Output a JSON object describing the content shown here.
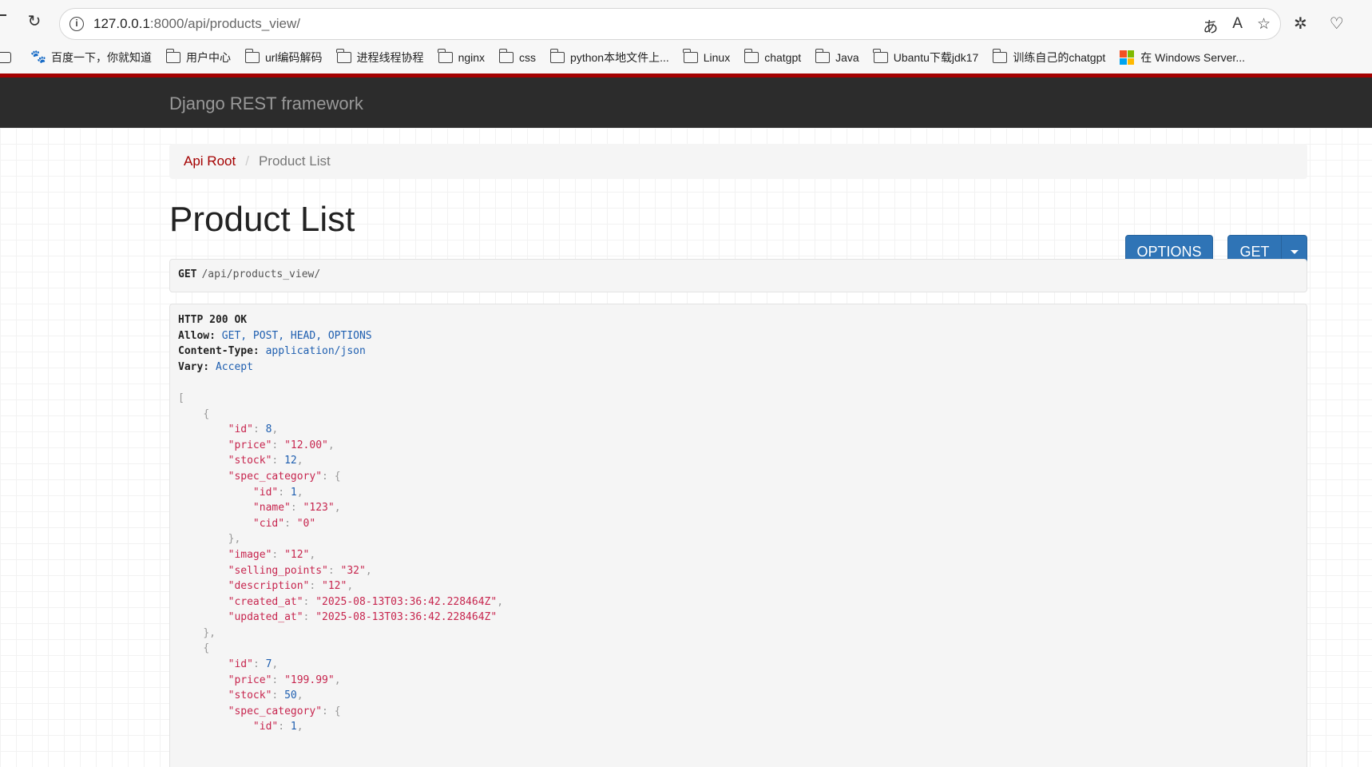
{
  "browser": {
    "url_host": "127.0.0.1",
    "url_path": ":8000/api/products_view/",
    "bookmarks": [
      {
        "label": "百度一下，你就知道",
        "icon": "paw-icon"
      },
      {
        "label": "用户中心",
        "icon": "folder-icon"
      },
      {
        "label": "url编码解码",
        "icon": "folder-icon"
      },
      {
        "label": "进程线程协程",
        "icon": "folder-icon"
      },
      {
        "label": "nginx",
        "icon": "folder-icon"
      },
      {
        "label": "css",
        "icon": "folder-icon"
      },
      {
        "label": "python本地文件上...",
        "icon": "folder-icon"
      },
      {
        "label": "Linux",
        "icon": "folder-icon"
      },
      {
        "label": "chatgpt",
        "icon": "folder-icon"
      },
      {
        "label": "Java",
        "icon": "folder-icon"
      },
      {
        "label": "Ubantu下载jdk17",
        "icon": "folder-icon"
      },
      {
        "label": "训练自己的chatgpt",
        "icon": "folder-icon"
      },
      {
        "label": "在 Windows Server...",
        "icon": "windows-icon"
      }
    ]
  },
  "navbar": {
    "brand": "Django REST framework"
  },
  "breadcrumb": {
    "root": "Api Root",
    "separator": "/",
    "current": "Product List"
  },
  "page": {
    "title": "Product List"
  },
  "buttons": {
    "options": "OPTIONS",
    "get": "GET"
  },
  "request": {
    "method": "GET",
    "path": "/api/products_view/"
  },
  "response": {
    "status": "HTTP 200 OK",
    "headers": [
      {
        "key": "Allow:",
        "value": "GET, POST, HEAD, OPTIONS"
      },
      {
        "key": "Content-Type:",
        "value": "application/json"
      },
      {
        "key": "Vary:",
        "value": "Accept"
      }
    ]
  },
  "products": [
    {
      "id": "8",
      "price": "\"12.00\"",
      "stock": "12",
      "spec_category": {
        "id": "1",
        "name": "\"123\"",
        "cid": "\"0\""
      },
      "image": "\"12\"",
      "selling_points": "\"32\"",
      "description": "\"12\"",
      "created_at": "\"2025-08-13T03:36:42.228464Z\"",
      "updated_at": "\"2025-08-13T03:36:42.228464Z\""
    },
    {
      "id": "7",
      "price": "\"199.99\"",
      "stock": "50",
      "spec_category": {
        "id": "1"
      }
    }
  ],
  "keys": {
    "id": "\"id\"",
    "price": "\"price\"",
    "stock": "\"stock\"",
    "spec_category": "\"spec_category\"",
    "name": "\"name\"",
    "cid": "\"cid\"",
    "image": "\"image\"",
    "selling_points": "\"selling_points\"",
    "description": "\"description\"",
    "created_at": "\"created_at\"",
    "updated_at": "\"updated_at\""
  }
}
